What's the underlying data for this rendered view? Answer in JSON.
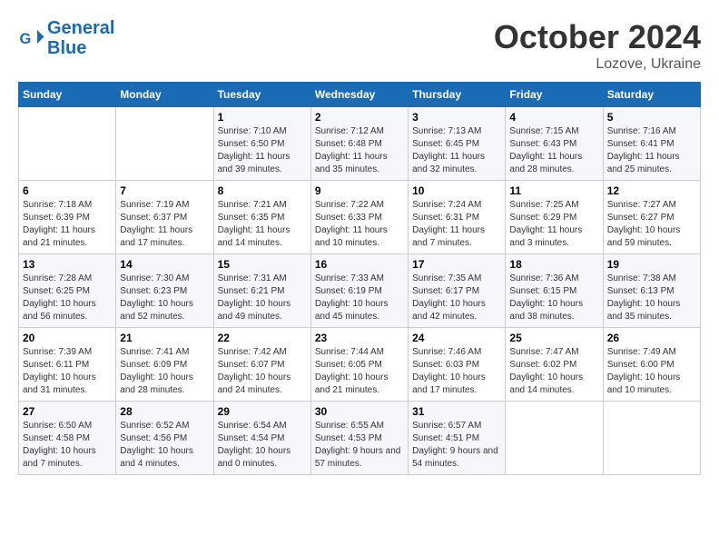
{
  "logo": {
    "line1": "General",
    "line2": "Blue"
  },
  "title": "October 2024",
  "subtitle": "Lozove, Ukraine",
  "headers": [
    "Sunday",
    "Monday",
    "Tuesday",
    "Wednesday",
    "Thursday",
    "Friday",
    "Saturday"
  ],
  "weeks": [
    [
      {
        "day": "",
        "info": ""
      },
      {
        "day": "",
        "info": ""
      },
      {
        "day": "1",
        "info": "Sunrise: 7:10 AM\nSunset: 6:50 PM\nDaylight: 11 hours and 39 minutes."
      },
      {
        "day": "2",
        "info": "Sunrise: 7:12 AM\nSunset: 6:48 PM\nDaylight: 11 hours and 35 minutes."
      },
      {
        "day": "3",
        "info": "Sunrise: 7:13 AM\nSunset: 6:45 PM\nDaylight: 11 hours and 32 minutes."
      },
      {
        "day": "4",
        "info": "Sunrise: 7:15 AM\nSunset: 6:43 PM\nDaylight: 11 hours and 28 minutes."
      },
      {
        "day": "5",
        "info": "Sunrise: 7:16 AM\nSunset: 6:41 PM\nDaylight: 11 hours and 25 minutes."
      }
    ],
    [
      {
        "day": "6",
        "info": "Sunrise: 7:18 AM\nSunset: 6:39 PM\nDaylight: 11 hours and 21 minutes."
      },
      {
        "day": "7",
        "info": "Sunrise: 7:19 AM\nSunset: 6:37 PM\nDaylight: 11 hours and 17 minutes."
      },
      {
        "day": "8",
        "info": "Sunrise: 7:21 AM\nSunset: 6:35 PM\nDaylight: 11 hours and 14 minutes."
      },
      {
        "day": "9",
        "info": "Sunrise: 7:22 AM\nSunset: 6:33 PM\nDaylight: 11 hours and 10 minutes."
      },
      {
        "day": "10",
        "info": "Sunrise: 7:24 AM\nSunset: 6:31 PM\nDaylight: 11 hours and 7 minutes."
      },
      {
        "day": "11",
        "info": "Sunrise: 7:25 AM\nSunset: 6:29 PM\nDaylight: 11 hours and 3 minutes."
      },
      {
        "day": "12",
        "info": "Sunrise: 7:27 AM\nSunset: 6:27 PM\nDaylight: 10 hours and 59 minutes."
      }
    ],
    [
      {
        "day": "13",
        "info": "Sunrise: 7:28 AM\nSunset: 6:25 PM\nDaylight: 10 hours and 56 minutes."
      },
      {
        "day": "14",
        "info": "Sunrise: 7:30 AM\nSunset: 6:23 PM\nDaylight: 10 hours and 52 minutes."
      },
      {
        "day": "15",
        "info": "Sunrise: 7:31 AM\nSunset: 6:21 PM\nDaylight: 10 hours and 49 minutes."
      },
      {
        "day": "16",
        "info": "Sunrise: 7:33 AM\nSunset: 6:19 PM\nDaylight: 10 hours and 45 minutes."
      },
      {
        "day": "17",
        "info": "Sunrise: 7:35 AM\nSunset: 6:17 PM\nDaylight: 10 hours and 42 minutes."
      },
      {
        "day": "18",
        "info": "Sunrise: 7:36 AM\nSunset: 6:15 PM\nDaylight: 10 hours and 38 minutes."
      },
      {
        "day": "19",
        "info": "Sunrise: 7:38 AM\nSunset: 6:13 PM\nDaylight: 10 hours and 35 minutes."
      }
    ],
    [
      {
        "day": "20",
        "info": "Sunrise: 7:39 AM\nSunset: 6:11 PM\nDaylight: 10 hours and 31 minutes."
      },
      {
        "day": "21",
        "info": "Sunrise: 7:41 AM\nSunset: 6:09 PM\nDaylight: 10 hours and 28 minutes."
      },
      {
        "day": "22",
        "info": "Sunrise: 7:42 AM\nSunset: 6:07 PM\nDaylight: 10 hours and 24 minutes."
      },
      {
        "day": "23",
        "info": "Sunrise: 7:44 AM\nSunset: 6:05 PM\nDaylight: 10 hours and 21 minutes."
      },
      {
        "day": "24",
        "info": "Sunrise: 7:46 AM\nSunset: 6:03 PM\nDaylight: 10 hours and 17 minutes."
      },
      {
        "day": "25",
        "info": "Sunrise: 7:47 AM\nSunset: 6:02 PM\nDaylight: 10 hours and 14 minutes."
      },
      {
        "day": "26",
        "info": "Sunrise: 7:49 AM\nSunset: 6:00 PM\nDaylight: 10 hours and 10 minutes."
      }
    ],
    [
      {
        "day": "27",
        "info": "Sunrise: 6:50 AM\nSunset: 4:58 PM\nDaylight: 10 hours and 7 minutes."
      },
      {
        "day": "28",
        "info": "Sunrise: 6:52 AM\nSunset: 4:56 PM\nDaylight: 10 hours and 4 minutes."
      },
      {
        "day": "29",
        "info": "Sunrise: 6:54 AM\nSunset: 4:54 PM\nDaylight: 10 hours and 0 minutes."
      },
      {
        "day": "30",
        "info": "Sunrise: 6:55 AM\nSunset: 4:53 PM\nDaylight: 9 hours and 57 minutes."
      },
      {
        "day": "31",
        "info": "Sunrise: 6:57 AM\nSunset: 4:51 PM\nDaylight: 9 hours and 54 minutes."
      },
      {
        "day": "",
        "info": ""
      },
      {
        "day": "",
        "info": ""
      }
    ]
  ]
}
